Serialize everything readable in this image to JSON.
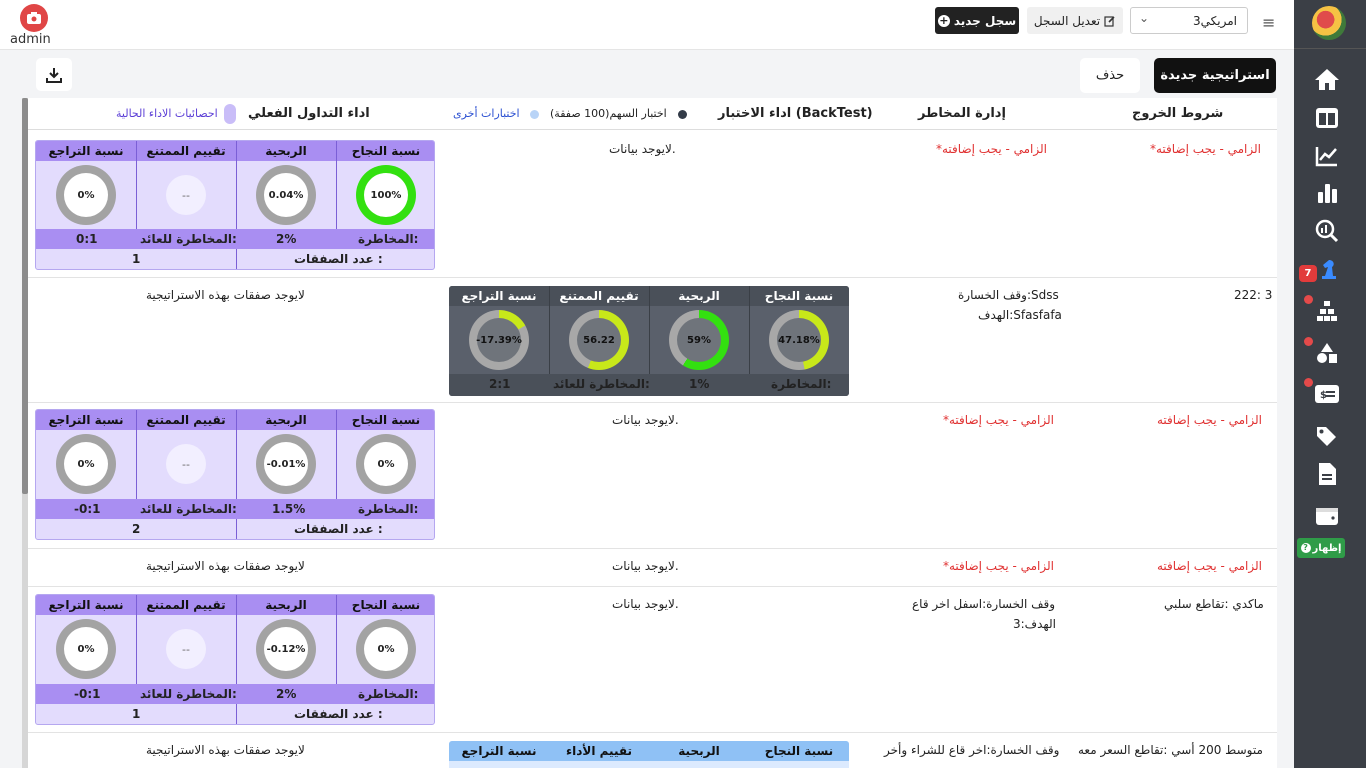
{
  "app": {
    "user": "admin"
  },
  "topbar": {
    "market_select": "امريكي3",
    "edit_label": "تعديل السجل",
    "new_label": "سجل جديد"
  },
  "toolbar": {
    "new_strategy": "استراتيجية جديدة",
    "delete": "حذف"
  },
  "rail": {
    "badge": "7",
    "show_label": "إظهار"
  },
  "table": {
    "headers": {
      "exit": "شروط الخروج",
      "risk": "إدارة المخاطر",
      "backtest": "اداء الاختبار (BackTest)",
      "stock_test": "اختبار السهم(100 صفقة)",
      "other_tests": "اختبارات أخرى",
      "live": "اداء التداول الفعلي",
      "current_stats": "احصائيات الاداء الحالية"
    },
    "metric_labels": {
      "success": "نسبة النجاح",
      "profit": "الربحية",
      "rating": "تقييم الممتنع",
      "rating_alt": "تقييم الأداء",
      "drawdown": "نسبة التراجع",
      "risk": "المخاطرة:",
      "rr": "المخاطرة للعائد:",
      "trades": "عدد الصفقات :"
    },
    "no_data": "لايوجد بيانات.",
    "no_trades": "لايوجد صفقات بهذه الاستراتيجية",
    "rows": [
      {
        "exit": "*الزامي - يجب إضافته",
        "risk": "*الزامي - يجب إضافته",
        "backtest": "لايوجد بيانات.",
        "live": {
          "success": "100%",
          "profit": "0.04%",
          "rating": "--",
          "drawdown": "0%",
          "risk": "2%",
          "rr": "0:1",
          "trades": "1"
        }
      },
      {
        "exit": "222: 3",
        "risk_l1": "وقف الخسارة:Sdss",
        "risk_l2": "الهدف:Sfasfafa",
        "backtest": {
          "success": "47.18%",
          "profit": "59%",
          "rating": "56.22",
          "drawdown": "-17.39%",
          "risk": "1%",
          "rr": "2:1"
        },
        "live": "لايوجد صفقات بهذه الاستراتيجية"
      },
      {
        "exit": "الزامي - يجب إضافته",
        "risk": "*الزامي - يجب إضافته",
        "backtest": "لايوجد بيانات.",
        "live": {
          "success": "0%",
          "profit": "-0.01%",
          "rating": "--",
          "drawdown": "0%",
          "risk": "1.5%",
          "rr": "-0:1",
          "trades": "2"
        }
      },
      {
        "exit": "الزامي - يجب إضافته",
        "risk": "*الزامي - يجب إضافته",
        "backtest": "لايوجد بيانات.",
        "live": "لايوجد صفقات بهذه الاستراتيجية"
      },
      {
        "exit": "ماكدي :تقاطع سلبي",
        "risk_l1": "وقف الخسارة:اسفل اخر قاع",
        "risk_l2": "الهدف:3",
        "backtest": "لايوجد بيانات.",
        "live": {
          "success": "0%",
          "profit": "-0.12%",
          "rating": "--",
          "drawdown": "0%",
          "risk": "2%",
          "rr": "-0:1",
          "trades": "1"
        }
      },
      {
        "exit": "متوسط 200 أسي :تقاطع السعر معه",
        "risk_l1": "وقف الخسارة:اخر قاع للشراء وأخر",
        "live": "لايوجد صفقات بهذه الاستراتيجية"
      }
    ]
  },
  "colors": {
    "accent_purple": "#a98ef2",
    "required_red": "#e03131",
    "green_ring": "#33e010",
    "lime_ring": "#c8e81a"
  }
}
